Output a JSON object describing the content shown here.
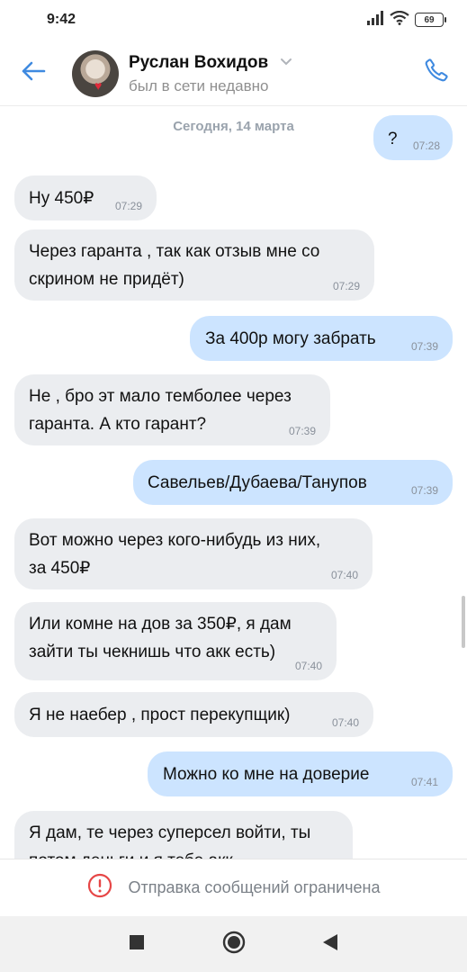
{
  "status_bar": {
    "time": "9:42",
    "battery": "69",
    "icons": [
      "signal-icon",
      "wifi-icon",
      "battery-icon"
    ]
  },
  "header": {
    "name": "Руслан Вохидов",
    "status": "был в сети недавно",
    "icons": [
      "back-arrow-icon",
      "chevron-down-icon",
      "phone-icon"
    ]
  },
  "chat": {
    "date": "Сегодня, 14 марта",
    "messages": [
      {
        "dir": "out",
        "text": [
          "?"
        ],
        "time": "07:28"
      },
      {
        "dir": "in",
        "text": [
          "Ну 450₽"
        ],
        "time": "07:29"
      },
      {
        "dir": "in",
        "text": [
          "Через гаранта , так как отзыв мне со",
          "скрином не придёт)"
        ],
        "time": "07:29"
      },
      {
        "dir": "out",
        "text": [
          "За 400р могу забрать"
        ],
        "time": "07:39"
      },
      {
        "dir": "in",
        "text": [
          "Не , бро эт мало темболее через",
          "гаранта. А кто гарант?"
        ],
        "time": "07:39"
      },
      {
        "dir": "out",
        "text": [
          "Савельев/Дубаева/Танупов"
        ],
        "time": "07:39"
      },
      {
        "dir": "in",
        "text": [
          "Вот можно через кого-нибудь из них,",
          "за 450₽"
        ],
        "time": "07:40"
      },
      {
        "dir": "in",
        "text": [
          "Или комне на дов за 350₽, я дам",
          "зайти ты чекнишь что акк есть)"
        ],
        "time": "07:40"
      },
      {
        "dir": "in",
        "text": [
          "Я не наебер , прост перекупщик)"
        ],
        "time": "07:40"
      },
      {
        "dir": "out",
        "text": [
          "Можно ко мне на доверие"
        ],
        "time": "07:41"
      },
      {
        "dir": "in",
        "text": [
          "Я дам, те через суперсел войти, ты",
          "потом деньги и я тебе акк"
        ],
        "time": ""
      }
    ]
  },
  "notice": {
    "text": "Отправка сообщений ограничена",
    "icon": "alert-circle-icon",
    "color": "#e64646"
  },
  "navbar": {
    "icons": [
      "square-icon",
      "circle-home-icon",
      "triangle-back-icon"
    ]
  },
  "colors": {
    "accent": "#3f8ae0",
    "bubble_in": "#ebedf0",
    "bubble_out": "#cce4ff"
  }
}
